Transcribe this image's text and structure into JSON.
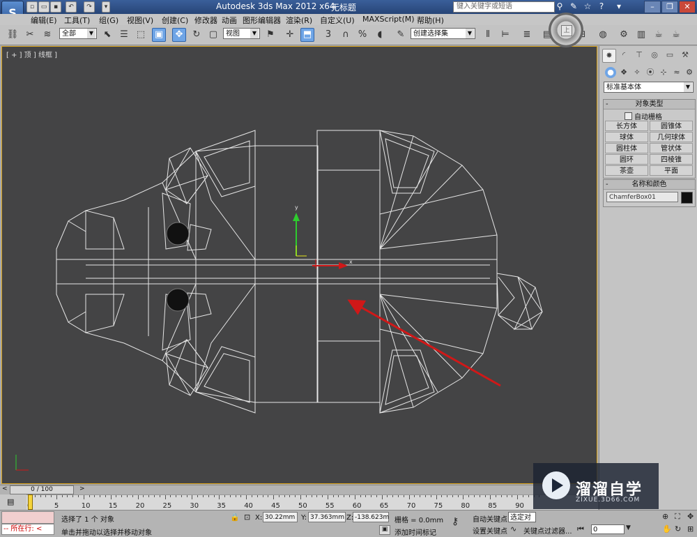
{
  "title": {
    "app": "Autodesk 3ds Max  2012 x64",
    "document": "无标题",
    "search_placeholder": "键入关键字或短语"
  },
  "menus": [
    "编辑(E)",
    "工具(T)",
    "组(G)",
    "视图(V)",
    "创建(C)",
    "修改器",
    "动画",
    "图形编辑器",
    "渲染(R)",
    "自定义(U)",
    "MAXScript(M)",
    "帮助(H)"
  ],
  "toolbar": {
    "selection_filter": "全部",
    "reference_coord": "视图",
    "named_selection": "创建选择集"
  },
  "viewport": {
    "label": "[ + ] 顶 ] 线框 ]",
    "gizmo_x": "x",
    "gizmo_y": "y"
  },
  "command_panel": {
    "category": "标准基本体",
    "object_type_header": "对象类型",
    "autogrid_label": "自动栅格",
    "objects": [
      "长方体",
      "圆锥体",
      "球体",
      "几何球体",
      "圆柱体",
      "管状体",
      "圆环",
      "四棱锥",
      "茶壶",
      "平面"
    ],
    "name_color_header": "名称和颜色",
    "object_name": "ChamferBox01",
    "object_color": "#101010"
  },
  "timeline": {
    "position": "0 / 100",
    "ticks": [
      "0",
      "5",
      "10",
      "15",
      "20",
      "25",
      "30",
      "35",
      "40",
      "45",
      "50",
      "55",
      "60",
      "65",
      "70",
      "75",
      "80",
      "85",
      "90"
    ]
  },
  "status": {
    "maxscript_label": "所在行:",
    "selection_message": "选择了 1 个 对象",
    "prompt_message": "单击并拖动以选择并移动对象",
    "x_label": "X:",
    "x_value": "30.22mm",
    "y_label": "Y:",
    "y_value": "37.363mm",
    "z_label": "Z:",
    "z_value": "-138.623m",
    "grid": "栅格 = 0.0mm",
    "add_time_tag": "添加时间标记",
    "auto_key": "自动关键点",
    "set_key": "设置关键点",
    "selected_object": "选定对象",
    "key_filters": "关键点过滤器...",
    "current_frame": "0"
  },
  "watermark": {
    "title": "溜溜自学",
    "url": "ZIXUE.3D66.COM"
  },
  "colors": {
    "viewport_bg": "#444445",
    "active_border": "#d8a21a",
    "annotation_arrow": "#d01818"
  }
}
